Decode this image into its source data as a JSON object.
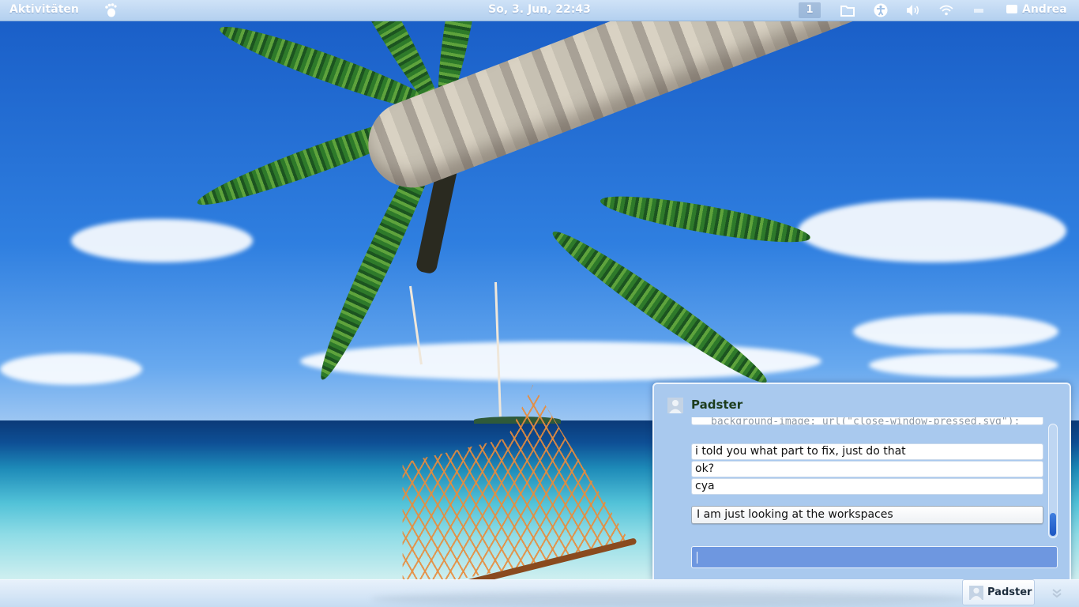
{
  "topbar": {
    "activities_label": "Aktivitäten",
    "clock": "So,  3. Jun, 22:43",
    "workspace_number": "1",
    "user_name": "Andrea",
    "icons": [
      "foot-icon",
      "files-icon",
      "accessibility-icon",
      "volume-icon",
      "wifi-icon",
      "battery-icon",
      "chat-bubble-icon"
    ]
  },
  "chat": {
    "contact_name": "Padster",
    "messages": [
      {
        "text": "background-image: url(\"close-window-pressed.svg\");",
        "from": "contact",
        "clipped": true
      },
      {
        "text": "i told you what part to fix, just do that",
        "from": "contact"
      },
      {
        "text": "ok?",
        "from": "contact"
      },
      {
        "text": "cya",
        "from": "contact"
      },
      {
        "text": "I am just looking at the workspaces",
        "from": "me"
      }
    ],
    "reply_value": ""
  },
  "tray": {
    "item_label": "Padster"
  },
  "colors": {
    "topbar_bg": "#b3d0ef",
    "chat_bg": "#a9c9ee",
    "reply_input_bg": "#6e97e0",
    "scroll_thumb": "#1c56c2",
    "contact_name": "#1d3d1d"
  }
}
